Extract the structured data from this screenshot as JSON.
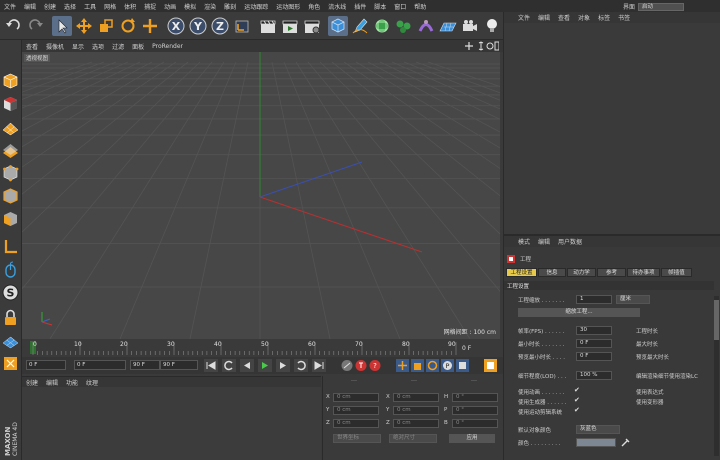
{
  "menubar": {
    "items": [
      "文件",
      "编辑",
      "创建",
      "选择",
      "工具",
      "网格",
      "体积",
      "捕捉",
      "动画",
      "模拟",
      "渲染",
      "雕刻",
      "运动跟踪",
      "运动图形",
      "角色",
      "流水线",
      "插件",
      "脚本",
      "窗口",
      "帮助"
    ],
    "layout_label": "界面",
    "layout_value": "启动"
  },
  "viewport": {
    "menu": [
      "查看",
      "摄像机",
      "显示",
      "选项",
      "过滤",
      "面板",
      "ProRender"
    ],
    "view_label": "透视视图",
    "grid_info": "网格间距 : 100 cm"
  },
  "timeline": {
    "ticks": [
      "0",
      "10",
      "20",
      "30",
      "40",
      "50",
      "60",
      "70",
      "80",
      "90"
    ],
    "end_label": "0 F"
  },
  "transport": {
    "start_frame": "0 F",
    "current_frame": "0 F",
    "end_frame": "90 F",
    "end_frame2": "90 F"
  },
  "material": {
    "menu": [
      "创建",
      "编辑",
      "功能",
      "纹理"
    ]
  },
  "coords": {
    "header": [
      "---",
      "---",
      "---"
    ],
    "rows": [
      {
        "a": "X",
        "av": "0 cm",
        "b": "X",
        "bv": "0 cm",
        "c": "H",
        "cv": "0 °"
      },
      {
        "a": "Y",
        "av": "0 cm",
        "b": "Y",
        "bv": "0 cm",
        "c": "P",
        "cv": "0 °"
      },
      {
        "a": "Z",
        "av": "0 cm",
        "b": "Z",
        "bv": "0 cm",
        "c": "B",
        "cv": "0 °"
      }
    ],
    "world_select": "世界坐标",
    "scale_select": "绝对尺寸",
    "apply_label": "应用"
  },
  "objects": {
    "menu": [
      "文件",
      "编辑",
      "查看",
      "对象",
      "标签",
      "书签"
    ]
  },
  "attributes": {
    "menu": [
      "模式",
      "编辑",
      "用户数据"
    ],
    "title": "工程",
    "tabs": [
      "工程设置",
      "信息",
      "动力学",
      "参考",
      "待办事项",
      "帧插值"
    ],
    "section": "工程设置",
    "scale_label": "工程缩放 . . . . . . .",
    "scale_value": "1",
    "scale_unit": "厘米",
    "scale_button": "缩放工程...",
    "fps_label": "帧率(FPS) . . . . . .",
    "fps_value": "30",
    "min_time_label": "最小时长 . . . . . . .",
    "min_time_value": "0 F",
    "preview_min_label": "预览最小时长 . . . .",
    "preview_min_value": "0 F",
    "lod_label": "细节程度(LOD) . . .",
    "lod_value": "100 %",
    "right_labels": [
      "工程时长",
      "最大时长",
      "预览最大时长"
    ],
    "lod_right": "编辑渲染细节使用渲染LC",
    "use_anim": "使用动画 . . . . . . .",
    "use_gen": "使用生成器 . . . . . .",
    "use_motion": "使用运动剪辑系统",
    "use_expr": "使用表达式",
    "use_deform": "使用变形器",
    "default_color_label": "默认对象颜色",
    "default_color_value": "灰蓝色",
    "color_label": "颜色 . . . . . . . . ."
  },
  "brand": {
    "maxon": "MAXON",
    "c4d": "CINEMA 4D"
  }
}
